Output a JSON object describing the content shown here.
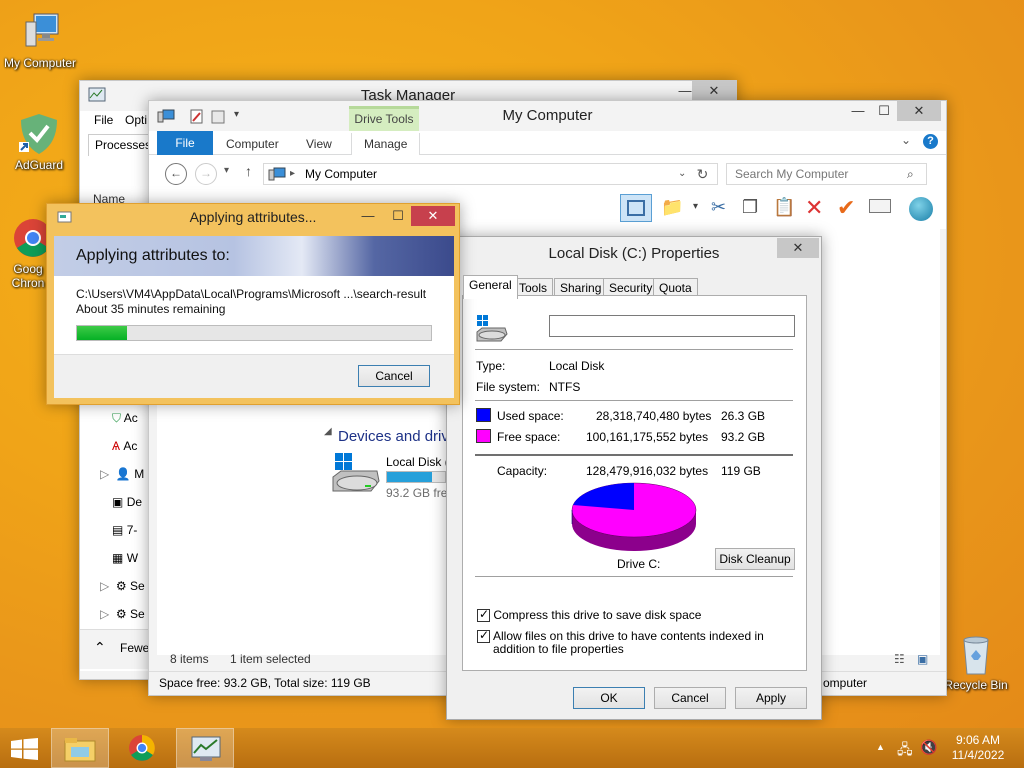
{
  "desktop": {
    "icons": [
      {
        "label": "My Computer"
      },
      {
        "label": "AdGuard"
      },
      {
        "label": "Goog Chron"
      },
      {
        "label": "Recycle Bin"
      }
    ]
  },
  "task_manager": {
    "title": "Task Manager",
    "menu": [
      "File",
      "Opti"
    ],
    "tab": "Processes",
    "col_header": "Name",
    "items": [
      "Ac",
      "Ac",
      "M",
      "De",
      "7-",
      "W",
      "Se",
      "Se"
    ],
    "fewer": "Fewe"
  },
  "my_computer": {
    "title": "My Computer",
    "context_tab": "Drive Tools",
    "tabs": [
      "File",
      "Computer",
      "View",
      "Manage"
    ],
    "address": "My Computer",
    "search_placeholder": "Search My Computer",
    "section": "Devices and driv",
    "drive_name": "Local Disk (",
    "drive_free": "93.2 GB free",
    "status_items": "8 items",
    "status_selected": "1 item selected",
    "footer": "Space free: 93.2 GB, Total size: 119 GB",
    "footer_right": "omputer"
  },
  "properties": {
    "title": "Local Disk (C:) Properties",
    "tabs": [
      "General",
      "Tools",
      "Sharing",
      "Security",
      "Quota"
    ],
    "name_value": "",
    "type_label": "Type:",
    "type_value": "Local Disk",
    "fs_label": "File system:",
    "fs_value": "NTFS",
    "used_label": "Used space:",
    "used_bytes": "28,318,740,480 bytes",
    "used_gb": "26.3 GB",
    "free_label": "Free space:",
    "free_bytes": "100,161,175,552 bytes",
    "free_gb": "93.2 GB",
    "cap_label": "Capacity:",
    "cap_bytes": "128,479,916,032 bytes",
    "cap_gb": "119 GB",
    "drive_label": "Drive C:",
    "cleanup": "Disk Cleanup",
    "compress": "Compress this drive to save disk space",
    "index": "Allow files on this drive to have contents indexed in addition to file properties",
    "ok": "OK",
    "cancel": "Cancel",
    "apply": "Apply",
    "used_fraction": 0.22,
    "colors": {
      "used": "#0000ff",
      "free": "#ff00ff"
    }
  },
  "applying": {
    "title": "Applying attributes...",
    "heading": "Applying attributes to:",
    "path": "C:\\Users\\VM4\\AppData\\Local\\Programs\\Microsoft ...\\search-result",
    "remaining": "About 35 minutes remaining",
    "progress": 0.14,
    "cancel": "Cancel"
  },
  "taskbar": {
    "time": "9:06 AM",
    "date": "11/4/2022"
  }
}
